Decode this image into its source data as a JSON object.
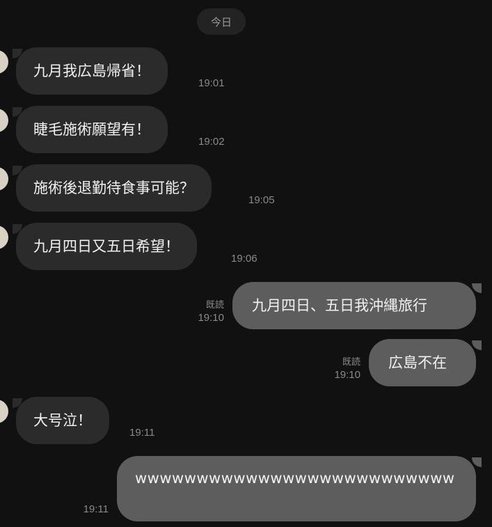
{
  "date_separator": "今日",
  "messages": [
    {
      "side": "in",
      "text": "九月我広島帰省！",
      "time": "19:01"
    },
    {
      "side": "in",
      "text": "睫毛施術願望有！",
      "time": "19:02"
    },
    {
      "side": "in",
      "text": "施術後退勤待食事可能？",
      "time": "19:05"
    },
    {
      "side": "in",
      "text": "九月四日又五日希望！",
      "time": "19:06"
    },
    {
      "side": "out",
      "text": "九月四日、五日我沖縄旅行",
      "time": "19:10",
      "status": "既読"
    },
    {
      "side": "out",
      "text": "広島不在",
      "time": "19:10",
      "status": "既読"
    },
    {
      "side": "in",
      "text": "大号泣！",
      "time": "19:11"
    },
    {
      "side": "out",
      "text": "wwwwwwwwwwwwwwwwwwwwwwwwww",
      "time": "19:11"
    }
  ],
  "colors": {
    "background": "#111111",
    "incoming_bubble": "#2b2b2b",
    "outgoing_bubble": "#5d5d5d",
    "meta_text": "#8a8a8a"
  }
}
